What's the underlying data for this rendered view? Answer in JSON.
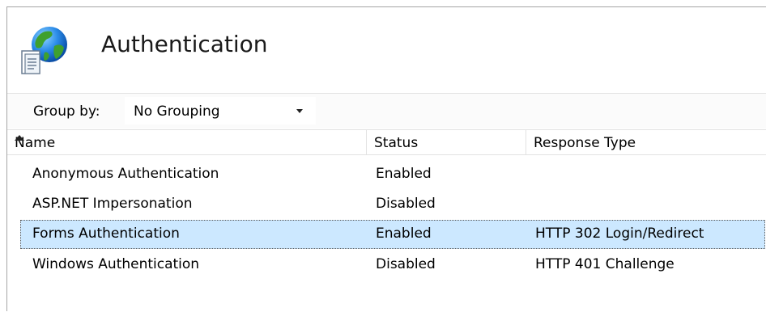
{
  "page": {
    "title": "Authentication",
    "icon": "authentication-globe-icon"
  },
  "toolbar": {
    "group_by_label": "Group by:",
    "group_by_value": "No Grouping"
  },
  "table": {
    "columns": [
      "Name",
      "Status",
      "Response Type"
    ],
    "sort": {
      "column": "Name",
      "direction": "ascending"
    },
    "rows": [
      {
        "name": "Anonymous Authentication",
        "status": "Enabled",
        "response_type": ""
      },
      {
        "name": "ASP.NET Impersonation",
        "status": "Disabled",
        "response_type": ""
      },
      {
        "name": "Forms Authentication",
        "status": "Enabled",
        "response_type": "HTTP 302 Login/Redirect",
        "selected": true
      },
      {
        "name": "Windows Authentication",
        "status": "Disabled",
        "response_type": "HTTP 401 Challenge"
      }
    ]
  },
  "colors": {
    "selection": "#cce8ff",
    "title": "#1a1a1a",
    "border": "#a5a5a5"
  }
}
